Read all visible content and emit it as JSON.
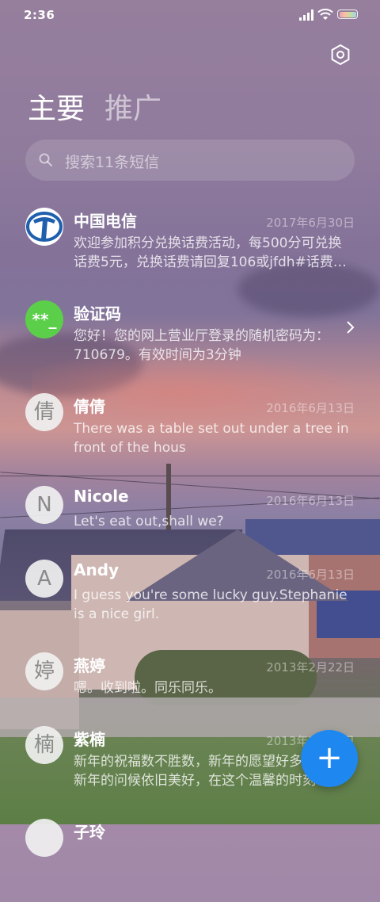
{
  "status_bar": {
    "time": "2:36"
  },
  "tabs": {
    "primary": "主要",
    "promotions": "推广"
  },
  "search": {
    "placeholder": "搜索11条短信"
  },
  "conversations": [
    {
      "avatar_type": "china-telecom-logo",
      "name": "中国电信",
      "date": "2017年6月30日",
      "preview": "欢迎参加积分兑换话费活动，每500分可兑换话费5元，兑换话费请回复106或jfdh#话费…"
    },
    {
      "avatar_type": "code-icon",
      "avatar_text": "**_",
      "name": "验证码",
      "date": "",
      "preview": "您好！您的网上营业厅登录的随机密码为：710679。有效时间为3分钟"
    },
    {
      "avatar_text": "倩",
      "name": "倩倩",
      "date": "2016年6月13日",
      "preview": "There was a table set out under a tree in front of the hous"
    },
    {
      "avatar_text": "N",
      "name": "Nicole",
      "date": "2016年6月13日",
      "preview": "Let's eat out,shall we?"
    },
    {
      "avatar_text": "A",
      "name": "Andy",
      "date": "2016年6月13日",
      "preview": "I guess you're some lucky guy.Stephanie is a nice girl."
    },
    {
      "avatar_text": "婷",
      "name": "燕婷",
      "date": "2013年2月22日",
      "preview": "嗯。收到啦。同乐同乐。"
    },
    {
      "avatar_text": "楠",
      "name": "紫楠",
      "date": "2013年2月22日",
      "preview": "新年的祝福数不胜数，新年的愿望好多好多，新年的问候依旧美好，在这个温馨的时刻…"
    },
    {
      "avatar_text": "",
      "name": "子玲",
      "date": "",
      "preview": ""
    }
  ],
  "fab": {
    "label": "+"
  },
  "colors": {
    "fab": "#1e88f0",
    "verification_avatar": "#5bcf4a",
    "telecom_blue": "#1e5fae"
  },
  "icons": [
    "cellular-signal-icon",
    "wifi-icon",
    "battery-icon",
    "settings-icon",
    "search-icon",
    "chevron-right-icon",
    "plus-icon"
  ]
}
